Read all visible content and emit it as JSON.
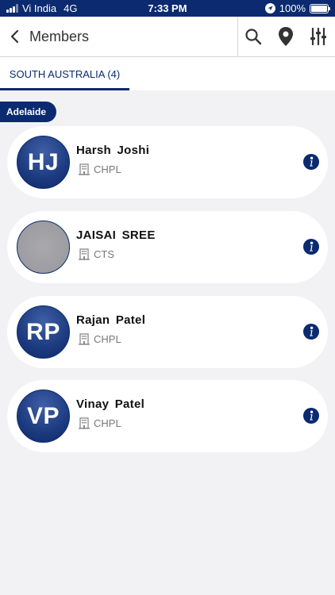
{
  "status_bar": {
    "carrier": "Vi India",
    "network": "4G",
    "time": "7:33 PM",
    "battery": "100%"
  },
  "app_bar": {
    "title": "Members",
    "actions": [
      "search-icon",
      "location-pin-icon",
      "filter-sliders-icon"
    ]
  },
  "tabs": [
    {
      "label": "SOUTH AUSTRALIA (4)",
      "selected": true
    }
  ],
  "group": {
    "label": "Adelaide"
  },
  "members": [
    {
      "initials": "HJ",
      "name": "Harsh  Joshi",
      "company": "CHPL",
      "photo": false
    },
    {
      "initials": "",
      "name": "JAISAI  SREE",
      "company": "CTS",
      "photo": true
    },
    {
      "initials": "RP",
      "name": "Rajan  Patel",
      "company": "CHPL",
      "photo": false
    },
    {
      "initials": "VP",
      "name": "Vinay  Patel",
      "company": "CHPL",
      "photo": false
    }
  ],
  "colors": {
    "primary": "#0b2a6f",
    "background": "#f2f2f4",
    "card": "#ffffff"
  }
}
